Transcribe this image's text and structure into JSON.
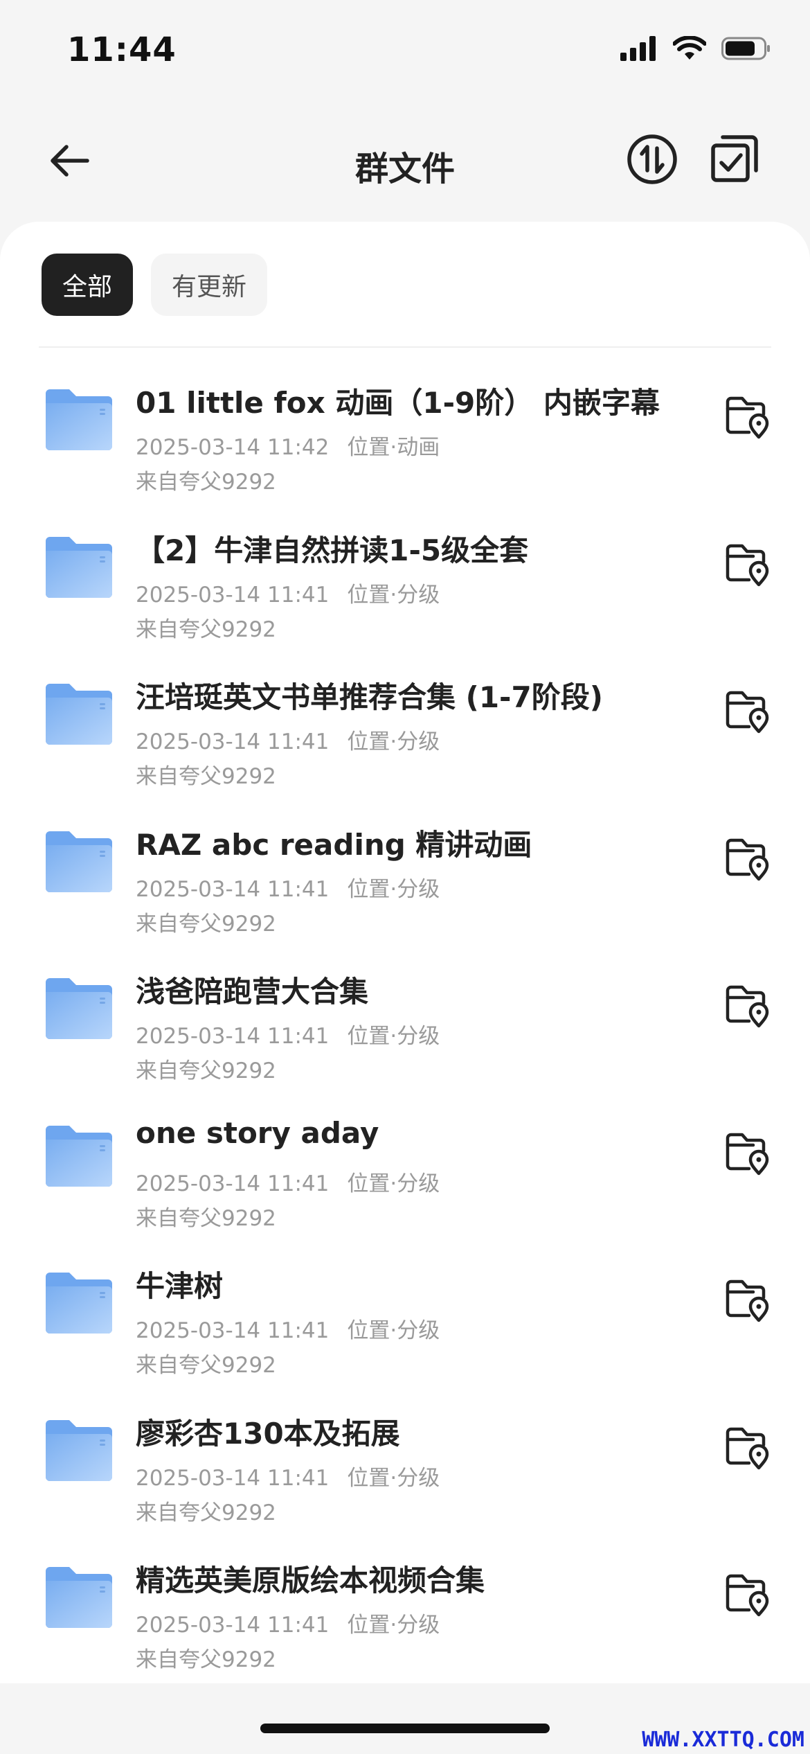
{
  "status": {
    "time": "11:44"
  },
  "nav": {
    "title": "群文件"
  },
  "filters": {
    "all": "全部",
    "updated": "有更新"
  },
  "items": [
    {
      "title": "01 little fox 动画（1-9阶） 内嵌字幕",
      "time": "2025-03-14 11:42",
      "location": "位置·动画",
      "from": "来自夸父9292"
    },
    {
      "title": "【2】牛津自然拼读1-5级全套",
      "time": "2025-03-14 11:41",
      "location": "位置·分级",
      "from": "来自夸父9292"
    },
    {
      "title": "汪培珽英文书单推荐合集 (1-7阶段)",
      "time": "2025-03-14 11:41",
      "location": "位置·分级",
      "from": "来自夸父9292"
    },
    {
      "title": "RAZ  abc  reading 精讲动画",
      "time": "2025-03-14 11:41",
      "location": "位置·分级",
      "from": "来自夸父9292"
    },
    {
      "title": "浅爸陪跑营大合集",
      "time": "2025-03-14 11:41",
      "location": "位置·分级",
      "from": "来自夸父9292"
    },
    {
      "title": "one story  aday",
      "time": "2025-03-14 11:41",
      "location": "位置·分级",
      "from": "来自夸父9292"
    },
    {
      "title": "牛津树",
      "time": "2025-03-14 11:41",
      "location": "位置·分级",
      "from": "来自夸父9292"
    },
    {
      "title": "廖彩杏130本及拓展",
      "time": "2025-03-14 11:41",
      "location": "位置·分级",
      "from": "来自夸父9292"
    },
    {
      "title": "精选英美原版绘本视频合集",
      "time": "2025-03-14 11:41",
      "location": "位置·分级",
      "from": "来自夸父9292"
    }
  ],
  "watermark": "WWW.XXTTQ.COM",
  "icons": {
    "back": "arrow-left-icon",
    "sort": "sort-arrows-icon",
    "select": "multi-select-icon",
    "folder": "folder-icon",
    "location": "folder-location-icon"
  },
  "colors": {
    "accent": "#212121",
    "folder": "#7fb2f0",
    "muted": "#9a9a9a"
  }
}
